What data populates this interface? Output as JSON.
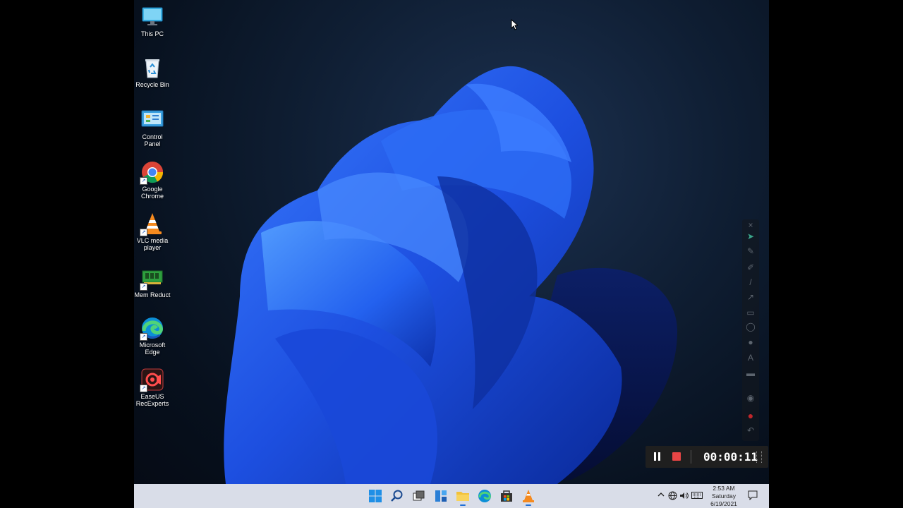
{
  "desktop": {
    "icons": [
      {
        "label": "This PC",
        "icon": "monitor-icon"
      },
      {
        "label": "Recycle Bin",
        "icon": "recycle-bin-icon"
      },
      {
        "label": "Control Panel",
        "icon": "control-panel-icon"
      },
      {
        "label": "Google Chrome",
        "icon": "chrome-icon"
      },
      {
        "label": "VLC media player",
        "icon": "vlc-icon"
      },
      {
        "label": "Mem Reduct",
        "icon": "memory-chip-icon"
      },
      {
        "label": "Microsoft Edge",
        "icon": "edge-icon"
      },
      {
        "label": "EaseUS RecExperts",
        "icon": "recexperts-icon"
      }
    ]
  },
  "recorder": {
    "elapsed": "00:00:11",
    "stop_color": "#e84545"
  },
  "pen_toolbar": {
    "tools": [
      "close-icon",
      "pointer-icon",
      "pen-icon",
      "highlighter-icon",
      "line-icon",
      "arrow-icon",
      "rectangle-icon",
      "ellipse-icon",
      "color-icon",
      "text-icon",
      "whiteboard-icon",
      "spotlight-icon",
      "record-dot-icon",
      "undo-icon"
    ]
  },
  "taskbar": {
    "apps": [
      "start-icon",
      "search-icon",
      "task-view-icon",
      "widgets-icon",
      "file-explorer-icon",
      "edge-icon",
      "store-icon",
      "vlc-icon"
    ],
    "tray": [
      "chevron-up-icon",
      "network-icon",
      "volume-icon",
      "keyboard-icon"
    ],
    "clock": {
      "time": "2:53 AM",
      "day": "Saturday",
      "date": "6/19/2021"
    },
    "accent": "#1f6fd6",
    "background": "#d9dde8"
  }
}
